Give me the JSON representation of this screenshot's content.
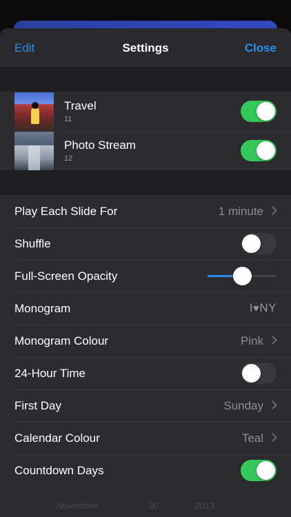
{
  "header": {
    "edit_label": "Edit",
    "title": "Settings",
    "close_label": "Close"
  },
  "albums": [
    {
      "name": "Travel",
      "count": "11",
      "enabled": true
    },
    {
      "name": "Photo Stream",
      "count": "12",
      "enabled": true
    }
  ],
  "settings": {
    "play_each_slide": {
      "label": "Play Each Slide For",
      "value": "1 minute"
    },
    "shuffle": {
      "label": "Shuffle",
      "enabled": false
    },
    "opacity": {
      "label": "Full-Screen Opacity",
      "level": 0.5
    },
    "monogram": {
      "label": "Monogram",
      "text_left": "I",
      "text_right": "NY"
    },
    "monogram_colour": {
      "label": "Monogram Colour",
      "value": "Pink"
    },
    "hour24": {
      "label": "24-Hour Time",
      "enabled": false
    },
    "first_day": {
      "label": "First Day",
      "value": "Sunday"
    },
    "calendar_colour": {
      "label": "Calendar Colour",
      "value": "Teal"
    },
    "countdown": {
      "label": "Countdown Days",
      "enabled": true
    }
  },
  "footer_peek": {
    "month": "November",
    "day": "30",
    "year": "2013"
  },
  "colors": {
    "accent": "#2a8ff0",
    "toggle_on": "#34c759",
    "sheet": "#2c2c2e"
  }
}
